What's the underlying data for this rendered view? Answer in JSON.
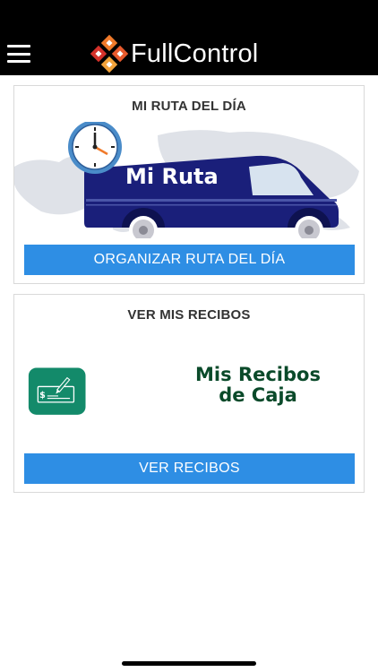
{
  "app": {
    "brand_name": "FullControl"
  },
  "cards": [
    {
      "title": "MI RUTA DEL DÍA",
      "image_text": "Mi Ruta",
      "button_label": "ORGANIZAR RUTA DEL DÍA"
    },
    {
      "title": "VER MIS RECIBOS",
      "image_text_line1": "Mis Recibos",
      "image_text_line2": "de Caja",
      "button_label": "VER RECIBOS"
    }
  ],
  "colors": {
    "header_bg": "#000000",
    "button_blue": "#2e8ee4",
    "van_navy": "#1a1f7a",
    "receipt_green": "#138a6a",
    "logo_orange": "#f07a2a",
    "logo_red": "#d4312a"
  }
}
